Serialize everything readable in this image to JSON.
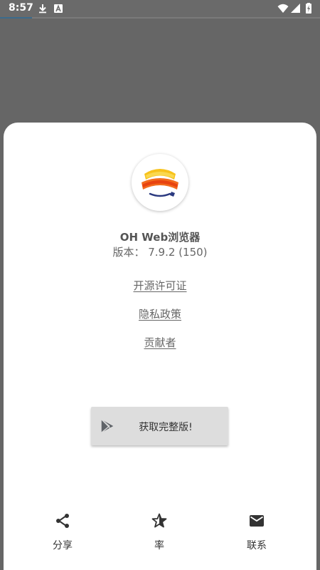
{
  "status_bar": {
    "time": "8:57",
    "progress_fraction": 0.1
  },
  "app": {
    "name": "OH Web浏览器",
    "version": "版本： 7.9.2 (150)"
  },
  "links": {
    "license": "开源许可证",
    "privacy": "隐私政策",
    "contributors": "贡献者"
  },
  "upgrade_button": {
    "label": "获取完整版!"
  },
  "actions": {
    "share": "分享",
    "rate": "率",
    "contact": "联系"
  },
  "colors": {
    "scrim": "#666666",
    "sheet": "#ffffff",
    "text": "#666666",
    "button_bg": "#dddddd",
    "progress": "#3b6b8c",
    "logo_yellow": "#f7c21b",
    "logo_orange": "#f26b1d",
    "logo_navy": "#2b3a80"
  }
}
